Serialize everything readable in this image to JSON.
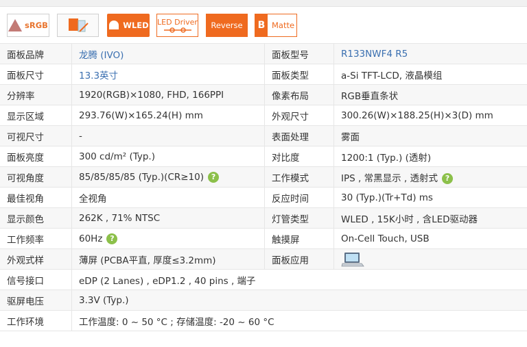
{
  "badges": {
    "srgb": "sRGB",
    "wled": "WLED",
    "led_driver": "LED Driver",
    "reverse": "Reverse",
    "matte_letter": "B",
    "matte": "Matte"
  },
  "rows": [
    {
      "k1": "面板品牌",
      "v1": "龙腾 (IVO)",
      "k2": "面板型号",
      "v2": "R133NWF4 R5"
    },
    {
      "k1": "面板尺寸",
      "v1": "13.3英寸",
      "k2": "面板类型",
      "v2": "a-Si TFT-LCD, 液晶模组"
    },
    {
      "k1": "分辨率",
      "v1": "1920(RGB)×1080, FHD, 166PPI",
      "k2": "像素布局",
      "v2": "RGB垂直条状"
    },
    {
      "k1": "显示区域",
      "v1": "293.76(W)×165.24(H) mm",
      "k2": "外观尺寸",
      "v2": "300.26(W)×188.25(H)×3(D) mm"
    },
    {
      "k1": "可视尺寸",
      "v1": "-",
      "k2": "表面处理",
      "v2": "雾面"
    },
    {
      "k1": "面板亮度",
      "v1": "300 cd/m² (Typ.)",
      "k2": "对比度",
      "v2": "1200:1 (Typ.) (透射)"
    },
    {
      "k1": "可视角度",
      "v1": "85/85/85/85 (Typ.)(CR≥10)",
      "k2": "工作模式",
      "v2": "IPS , 常黑显示 , 透射式"
    },
    {
      "k1": "最佳视角",
      "v1": "全视角",
      "k2": "反应时间",
      "v2": "30 (Typ.)(Tr+Td) ms"
    },
    {
      "k1": "显示颜色",
      "v1": "262K , 71% NTSC",
      "k2": "灯管类型",
      "v2": "WLED , 15K小时 , 含LED驱动器"
    },
    {
      "k1": "工作频率",
      "v1": "60Hz",
      "k2": "触摸屏",
      "v2": "On-Cell Touch, USB"
    },
    {
      "k1": "外观式样",
      "v1": "薄屏 (PCBA平直, 厚度≤3.2mm)",
      "k2": "面板应用",
      "v2": ""
    },
    {
      "k1": "信号接口",
      "v1": "eDP (2 Lanes) , eDP1.2 , 40 pins , 端子"
    },
    {
      "k1": "驱屏电压",
      "v1": "3.3V (Typ.)"
    },
    {
      "k1": "工作环境",
      "v1": "工作温度: 0 ~ 50 °C ; 存储温度: -20 ~ 60 °C"
    }
  ],
  "help_symbol": "?",
  "colors": {
    "accent": "#ef6a1f",
    "link": "#3a6fb0",
    "help": "#8cc04a"
  },
  "icons": {
    "application": "laptop-icon"
  }
}
